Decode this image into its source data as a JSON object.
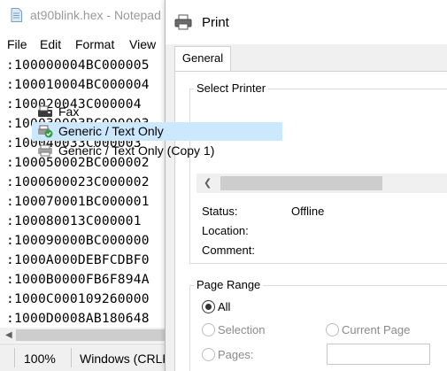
{
  "notepad": {
    "title": "at90blink.hex - Notepad",
    "menu": [
      "File",
      "Edit",
      "Format",
      "View"
    ],
    "lines": [
      ":100000004BC000005",
      ":100010004BC000004",
      ":100020043C000004",
      ":100030003BC000003",
      ":100040033C000003",
      ":100050002BC000002",
      ":1000600023C000002",
      ":100070001BC000001",
      ":100080013C000001",
      ":100090000BC000000",
      ":1000A000DEBFCDBF0",
      ":1000B0000FB6F894A",
      ":1000C000109260000",
      ":1000D0008AB180648"
    ],
    "status": {
      "zoom": "100%",
      "line_ending": "Windows (CRLF)"
    }
  },
  "print_dialog": {
    "title": "Print",
    "tab": "General",
    "select_printer_label": "Select Printer",
    "printers": [
      {
        "name": "Fax",
        "icon": "fax-printer-icon",
        "selected": false
      },
      {
        "name": "Generic / Text Only",
        "icon": "default-printer-icon",
        "selected": true
      },
      {
        "name": "Generic / Text Only (Copy 1)",
        "icon": "printer-icon",
        "selected": false
      }
    ],
    "status_label": "Status:",
    "status_value": "Offline",
    "location_label": "Location:",
    "location_value": "",
    "comment_label": "Comment:",
    "comment_value": "",
    "page_range": {
      "label": "Page Range",
      "all": "All",
      "selection": "Selection",
      "current_page": "Current Page",
      "pages": "Pages:",
      "pages_value": "",
      "selected_option": "All"
    }
  },
  "colors": {
    "selected_row": "#cce8ff",
    "dialog_bg": "#f0f0f0",
    "disabled_text": "#8a8a8a"
  }
}
